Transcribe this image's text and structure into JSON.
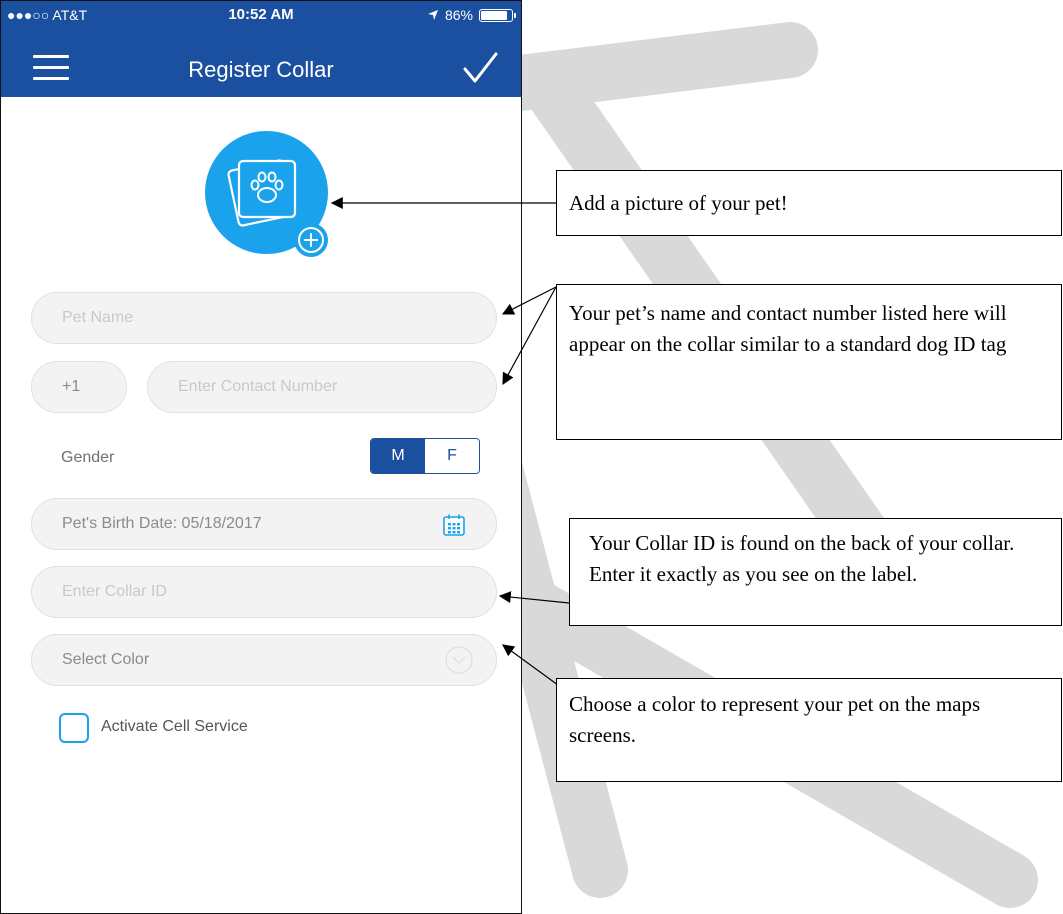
{
  "status_bar": {
    "carrier": "●●●○○ AT&T",
    "time": "10:52 AM",
    "battery": "86%",
    "battery_level": 0.86
  },
  "header": {
    "title": "Register Collar"
  },
  "form": {
    "pet_name_placeholder": "Pet Name",
    "country_code": "+1",
    "contact_placeholder": "Enter Contact Number",
    "gender_label": "Gender",
    "gender_options": [
      "M",
      "F"
    ],
    "gender_selected": "M",
    "birth_date": "Pet's Birth Date: 05/18/2017",
    "collar_id_placeholder": "Enter Collar ID",
    "color_select": "Select Color",
    "activate_cell_label": "Activate Cell Service",
    "activate_cell_checked": false
  },
  "callouts": {
    "photo": "Add a picture of your pet!",
    "name_contact": "Your pet’s name and contact number listed here will appear on the collar similar to a standard dog ID tag",
    "collar_id": "Your Collar ID is found on the back of your collar. Enter it exactly as you see on the label.",
    "color": "Choose a color to represent your pet on the maps screens."
  },
  "colors": {
    "header": "#1b4fa0",
    "accent": "#1aa3ec",
    "watermark": "#d4d4d4"
  }
}
